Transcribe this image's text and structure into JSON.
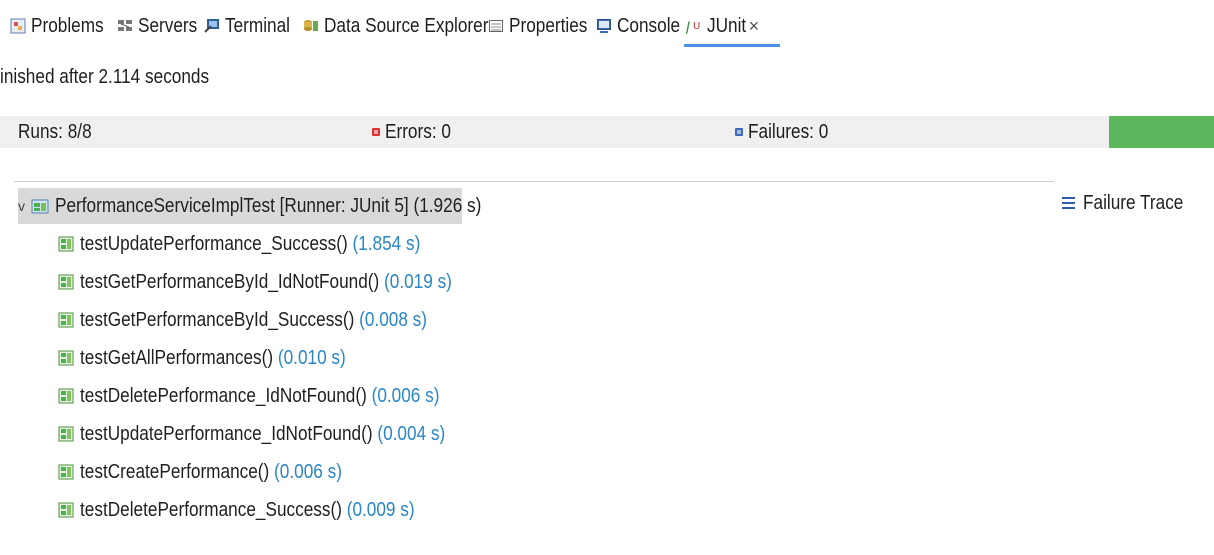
{
  "tabs": [
    {
      "label": "Problems",
      "icon": "problems-icon"
    },
    {
      "label": "Servers",
      "icon": "servers-icon"
    },
    {
      "label": "Terminal",
      "icon": "terminal-icon"
    },
    {
      "label": "Data Source Explorer",
      "icon": "data-source-explorer-icon"
    },
    {
      "label": "Properties",
      "icon": "properties-icon"
    },
    {
      "label": "Console",
      "icon": "console-icon"
    },
    {
      "label": "JUnit",
      "icon": "junit-icon",
      "active": true,
      "close_glyph": "×"
    }
  ],
  "status_text": "inished after 2.114 seconds",
  "counters": {
    "runs_label": "Runs:",
    "runs_value": "8/8",
    "errors_label": "Errors:",
    "errors_value": "0",
    "failures_label": "Failures:",
    "failures_value": "0",
    "progress_fraction": 1.0
  },
  "tree": {
    "root": {
      "name": "PerformanceServiceImplTest [Runner: JUnit 5]",
      "time": "(1.926 s)"
    },
    "tests": [
      {
        "name": "testUpdatePerformance_Success()",
        "time": "(1.854 s)"
      },
      {
        "name": "testGetPerformanceById_IdNotFound()",
        "time": "(0.019 s)"
      },
      {
        "name": "testGetPerformanceById_Success()",
        "time": "(0.008 s)"
      },
      {
        "name": "testGetAllPerformances()",
        "time": "(0.010 s)"
      },
      {
        "name": "testDeletePerformance_IdNotFound()",
        "time": "(0.006 s)"
      },
      {
        "name": "testUpdatePerformance_IdNotFound()",
        "time": "(0.004 s)"
      },
      {
        "name": "testCreatePerformance()",
        "time": "(0.006 s)"
      },
      {
        "name": "testDeletePerformance_Success()",
        "time": "(0.009 s)"
      }
    ]
  },
  "failure_trace_label": "Failure Trace",
  "colors": {
    "progress_green": "#5cb85c",
    "time_blue": "#2a86c8",
    "active_tab_underline": "#4a90e2",
    "selection_gray": "#d9d9d9"
  }
}
